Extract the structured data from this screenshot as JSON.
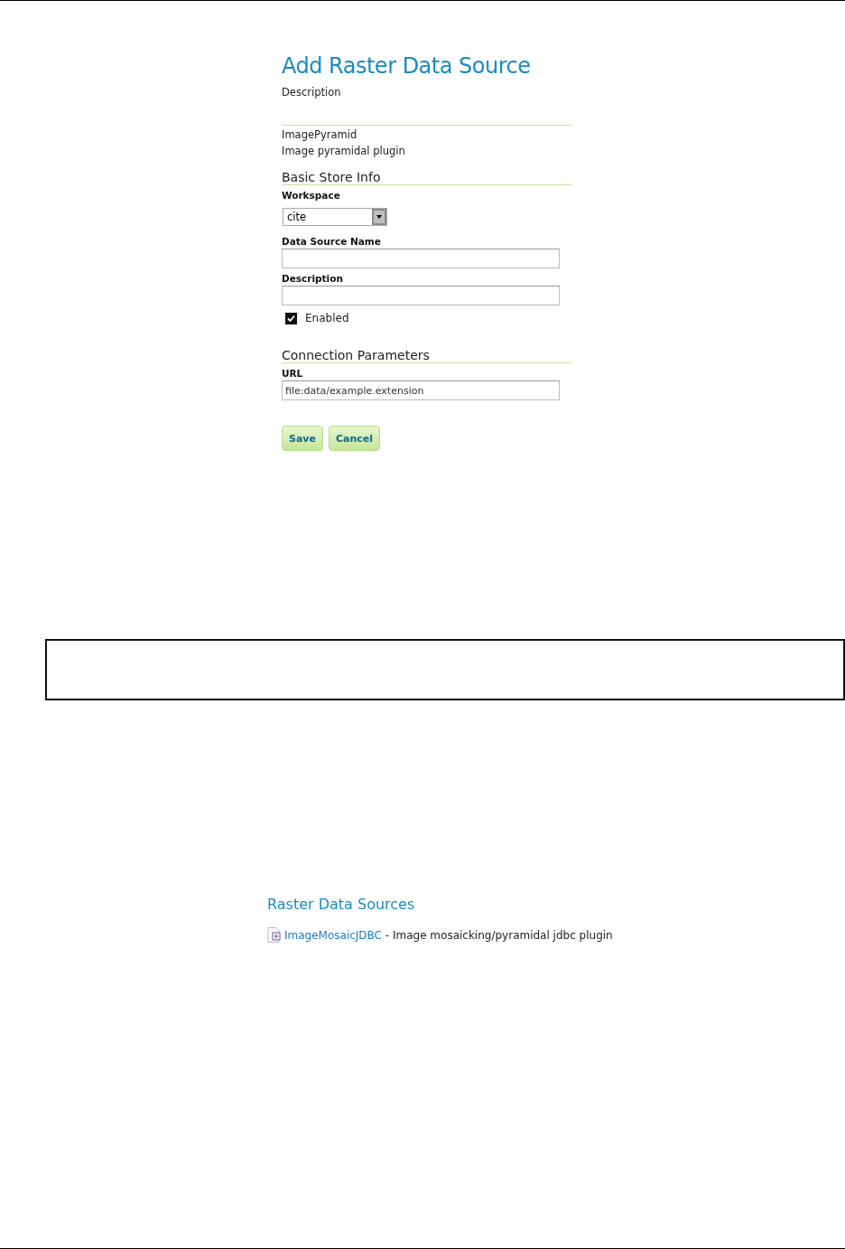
{
  "form": {
    "title": "Add Raster Data Source",
    "subtitle": "Description",
    "store_type": {
      "name": "ImagePyramid",
      "description": "Image pyramidal plugin"
    },
    "sections": [
      {
        "heading": "Basic Store Info",
        "fields": [
          {
            "kind": "select",
            "label": "Workspace",
            "value": "cite"
          },
          {
            "kind": "text",
            "label": "Data Source Name"
          },
          {
            "kind": "text",
            "label": "Description"
          },
          {
            "kind": "checkbox",
            "label": "Enabled",
            "checked": true
          }
        ]
      },
      {
        "heading": "Connection Parameters",
        "fields": [
          {
            "kind": "text",
            "label": "URL",
            "value": "file:data/example.extension"
          }
        ]
      }
    ],
    "buttons": [
      "Save",
      "Cancel"
    ]
  },
  "sources": {
    "title": "Raster Data Sources",
    "items": [
      {
        "name": "ImageMosaicJDBC",
        "description": " - Image mosaicking/pyramidal jdbc plugin"
      }
    ]
  }
}
